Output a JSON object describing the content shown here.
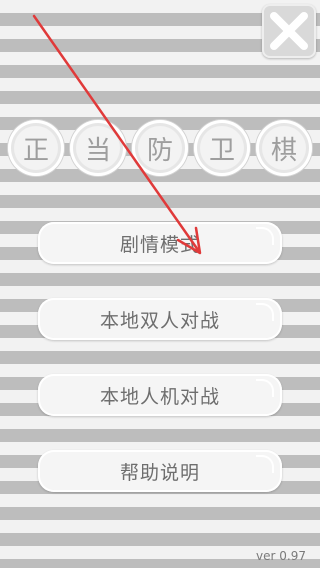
{
  "title_chars": [
    "正",
    "当",
    "防",
    "卫",
    "棋"
  ],
  "menu": {
    "story_mode": "剧情模式",
    "local_pvp": "本地双人对战",
    "local_pve": "本地人机对战",
    "help": "帮助说明"
  },
  "version": "ver 0.97",
  "icons": {
    "close": "close-x-icon",
    "arrow": "red-arrow-annotation"
  },
  "colors": {
    "stripe_light": "#f2f2f2",
    "stripe_dark": "#bdbdbd",
    "annotation_red": "#e03a3a"
  }
}
